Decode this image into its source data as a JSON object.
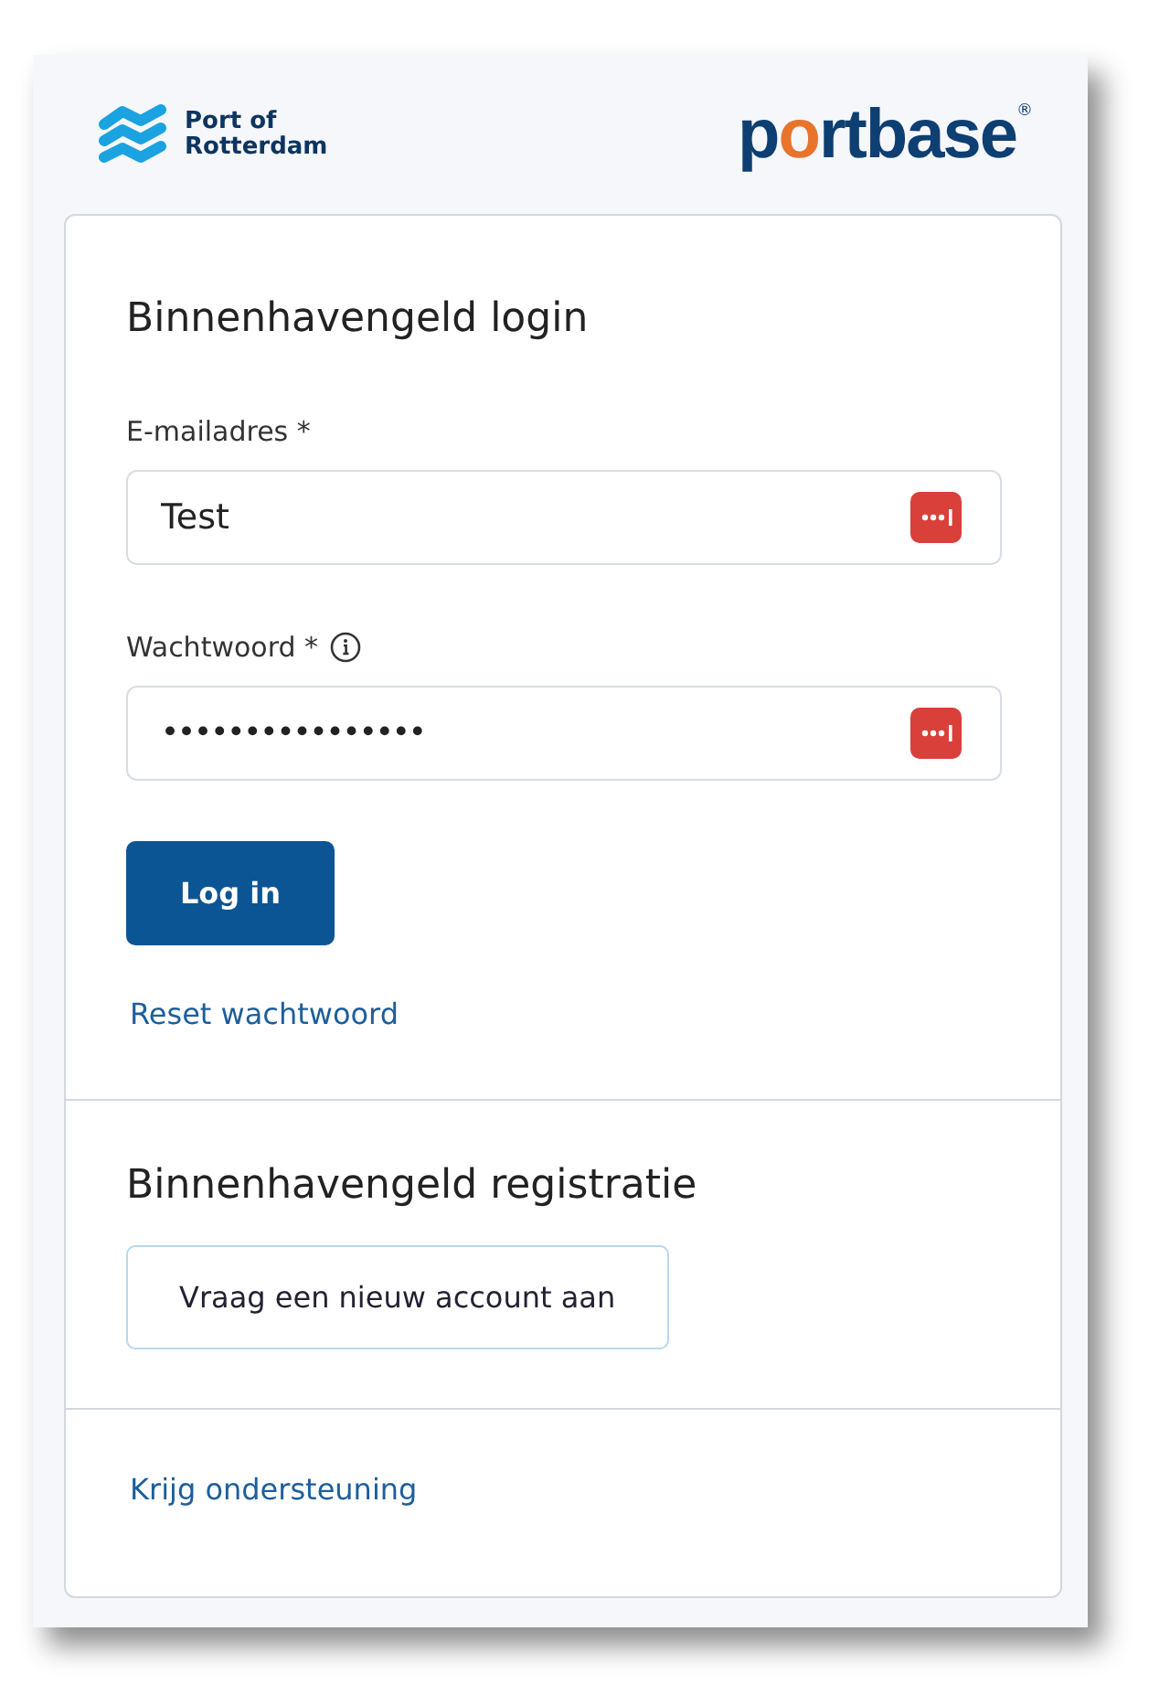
{
  "header": {
    "left_logo": {
      "line1": "Port of",
      "line2": "Rotterdam"
    },
    "right_logo": {
      "parts": [
        {
          "text": "p",
          "accent": false
        },
        {
          "text": "o",
          "accent": true
        },
        {
          "text": "rtbase",
          "accent": false
        }
      ],
      "mark": "®"
    }
  },
  "login": {
    "title": "Binnenhavengeld login",
    "fields": [
      {
        "label": "E-mailadres *",
        "value": "Test",
        "kind": "text",
        "info": false
      },
      {
        "label": "Wachtwoord *",
        "value": "••••••••••••••••",
        "kind": "password",
        "info": true
      }
    ],
    "button": "Log in",
    "link": "Reset wachtwoord"
  },
  "registration": {
    "title": "Binnenhavengeld registratie",
    "button": "Vraag een nieuw account aan"
  },
  "footer": {
    "link": "Krijg ondersteuning"
  }
}
